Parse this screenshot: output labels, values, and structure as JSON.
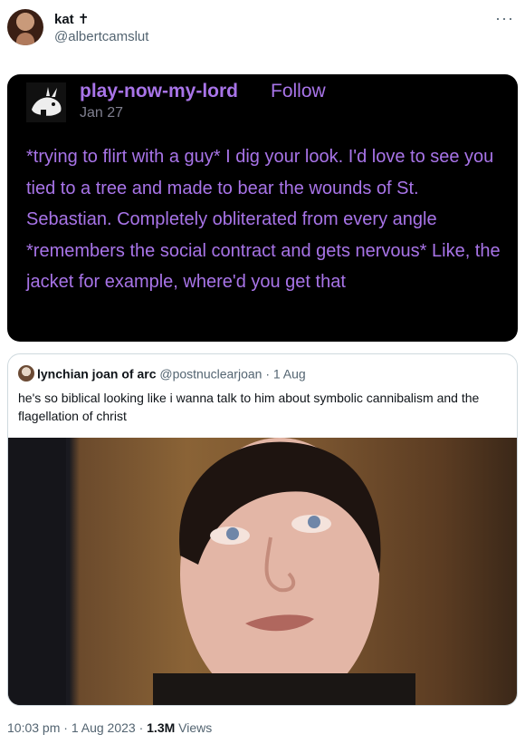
{
  "author": {
    "name": "kat ✝",
    "handle": "@albertcamslut"
  },
  "tumblr_post": {
    "username": "play-now-my-lord",
    "follow_label": "Follow",
    "date": "Jan 27",
    "text": "*trying to flirt with a guy* I dig your look. I'd love to see you tied to a tree and made to bear the wounds of St. Sebastian. Completely obliterated from every angle *remembers the social contract and gets nervous* Like, the jacket for example, where'd you get that"
  },
  "quoted_tweet": {
    "name": "lynchian joan of arc",
    "handle": "@postnuclearjoan",
    "separator": " · ",
    "date": "1 Aug",
    "text": "he's so biblical looking like i wanna talk to him about symbolic cannibalism and the flagellation of christ"
  },
  "footer": {
    "time": "10:03 pm",
    "separator": " · ",
    "date": "1 Aug 2023",
    "views_count": "1.3M",
    "views_label": "Views"
  },
  "more_icon": "more-horizontal-icon",
  "colors": {
    "tumblr_purple": "#a874e8",
    "tumblr_bg": "#000000",
    "muted": "#536471"
  }
}
